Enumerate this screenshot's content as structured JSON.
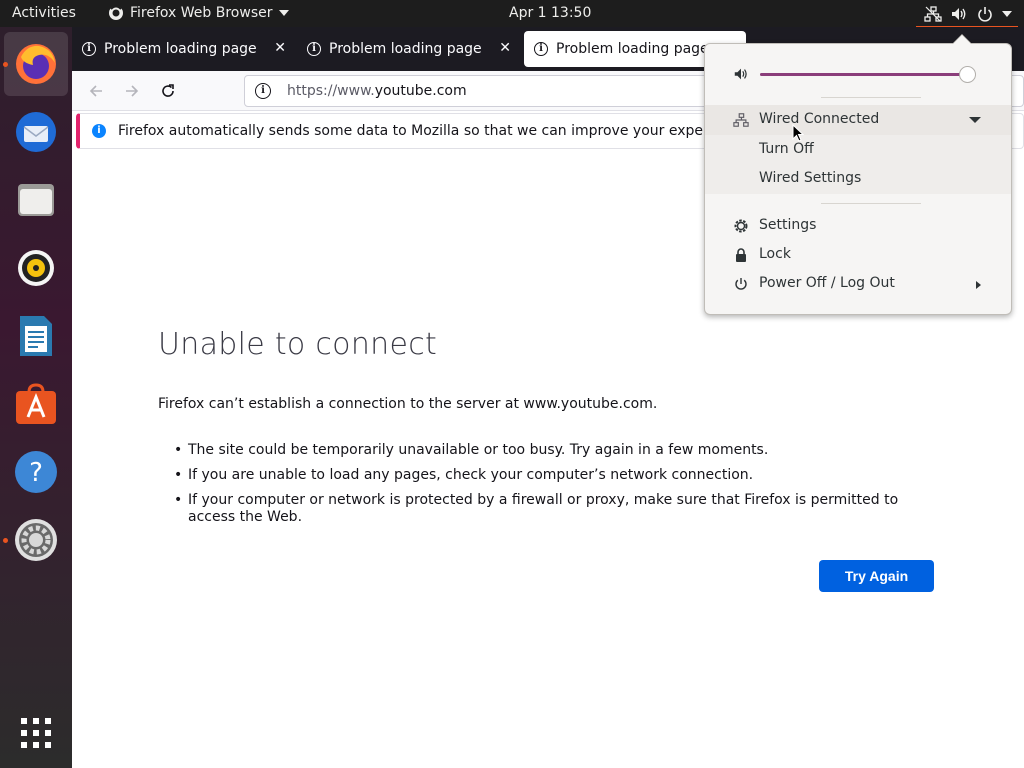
{
  "topbar": {
    "activities": "Activities",
    "app_menu": "Firefox Web Browser",
    "clock": "Apr 1  13:50"
  },
  "dock": {
    "apps": [
      "firefox-icon",
      "thunderbird-icon",
      "files-icon",
      "rhythmbox-icon",
      "writer-icon",
      "software-icon",
      "help-icon",
      "settings-icon"
    ],
    "show_apps": "app-grid-icon"
  },
  "browser": {
    "tabs": [
      {
        "label": "Problem loading page"
      },
      {
        "label": "Problem loading page"
      },
      {
        "label": "Problem loading page"
      }
    ],
    "url": {
      "prefix": "https://www.",
      "host": "youtube.com"
    },
    "notification": "Firefox automatically sends some data to Mozilla so that we can improve your experience."
  },
  "error": {
    "title": "Unable to connect",
    "description": "Firefox can’t establish a connection to the server at www.youtube.com.",
    "bullets": [
      "The site could be temporarily unavailable or too busy. Try again in a few moments.",
      "If you are unable to load any pages, check your computer’s network connection.",
      "If your computer or network is protected by a firewall or proxy, make sure that Firefox is permitted to access the Web."
    ],
    "button": "Try Again"
  },
  "system_menu": {
    "volume_level": 0.96,
    "wired": "Wired Connected",
    "turn_off": "Turn Off",
    "wired_settings": "Wired Settings",
    "settings": "Settings",
    "lock": "Lock",
    "power": "Power Off / Log Out"
  },
  "colors": {
    "accent": "#e95420",
    "button": "#0061e0",
    "slider": "#8a3d7a"
  }
}
